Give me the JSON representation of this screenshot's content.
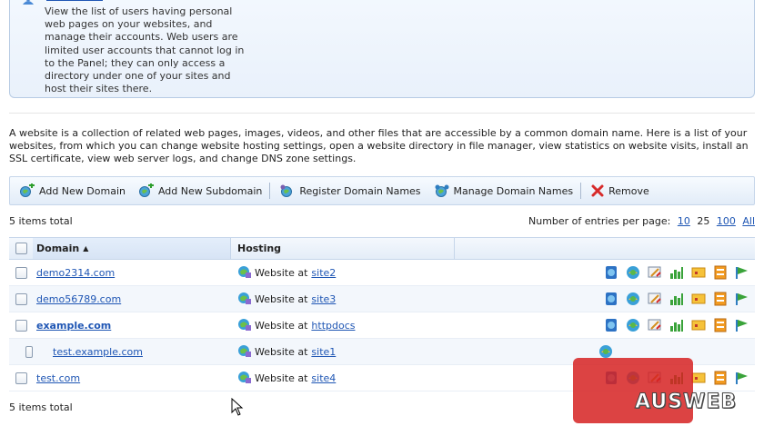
{
  "panel": {
    "icon": "users-icon",
    "text": "View the list of users having personal web pages on your websites, and manage their accounts. Web users are limited user accounts that cannot log in to the Panel; they can only access a directory under one of your sites and host their sites there."
  },
  "intro": "A website is a collection of related web pages, images, videos, and other files that are accessible by a common domain name. Here is a list of your websites, from which you can change website hosting settings, open a website directory in file manager, view statistics on website visits, install an SSL certificate, view web server logs, and change DNS zone settings.",
  "toolbar": {
    "add_domain": "Add New Domain",
    "add_subdomain": "Add New Subdomain",
    "register_domain": "Register Domain Names",
    "manage_domain": "Manage Domain Names",
    "remove": "Remove"
  },
  "list": {
    "total_top": "5 items total",
    "total_bottom": "5 items total",
    "per_page_label": "Number of entries per page:",
    "per_page_options": [
      "10",
      "25",
      "100",
      "All"
    ],
    "per_page_selected": "25"
  },
  "grid": {
    "col_domain": "Domain",
    "sort_indicator": "▲",
    "col_hosting": "Hosting",
    "rows": [
      {
        "domain": "demo2314.com",
        "hosting_prefix": "Website at",
        "hosting_site": "site2"
      },
      {
        "domain": "demo56789.com",
        "hosting_prefix": "Website at",
        "hosting_site": "site3"
      },
      {
        "domain": "example.com",
        "hosting_prefix": "Website at",
        "hosting_site": "httpdocs"
      },
      {
        "domain": "test.example.com",
        "hosting_prefix": "Website at",
        "hosting_site": "site1"
      },
      {
        "domain": "test.com",
        "hosting_prefix": "Website at",
        "hosting_site": "site4"
      }
    ]
  },
  "watermark": {
    "brand": "AUSWEB",
    "obscured_text": "Number of entries per page: 10 25 100 All"
  },
  "colors": {
    "link": "#1f56b4",
    "toolbar_border": "#c6d6ea",
    "watermark": "#d62222"
  }
}
